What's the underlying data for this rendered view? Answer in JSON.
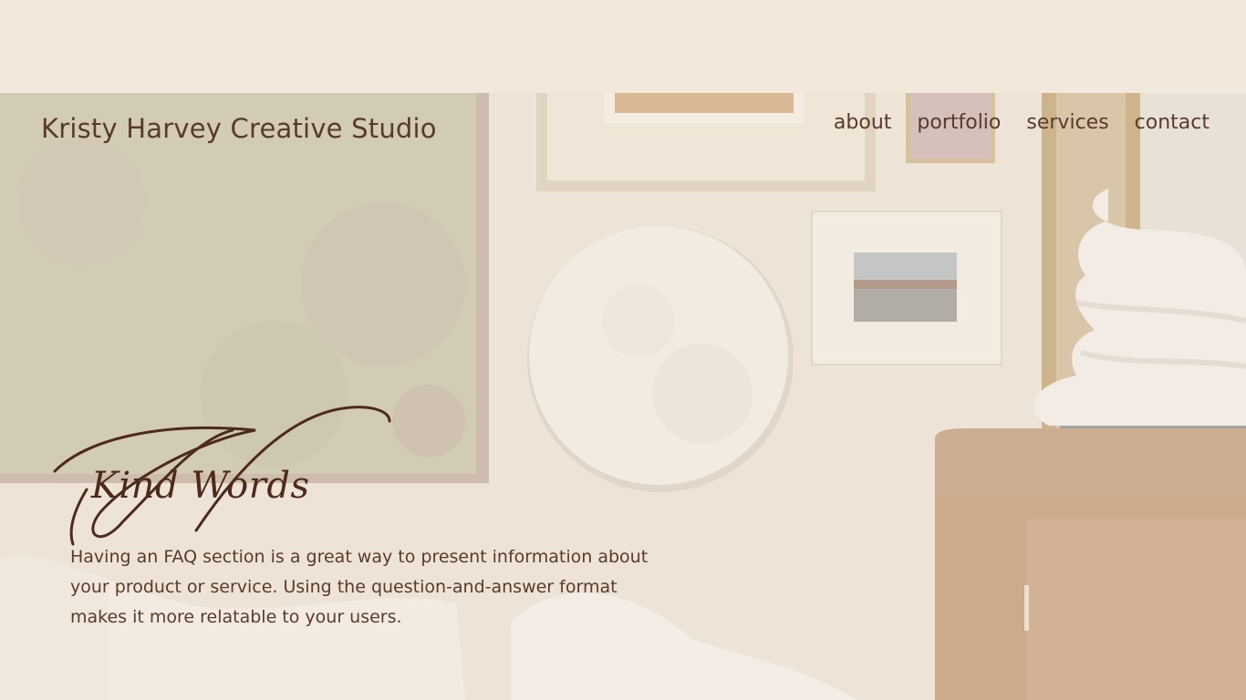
{
  "site": {
    "brand": "Kristy Harvey Creative Studio"
  },
  "nav": {
    "items": [
      {
        "label": "about"
      },
      {
        "label": "portfolio"
      },
      {
        "label": "services"
      },
      {
        "label": "contact"
      }
    ]
  },
  "section": {
    "heading": "Kind Words",
    "body": "Having an FAQ section is a great way to present information about your product or service. Using the question-and-answer format makes it more relatable to your users."
  },
  "colors": {
    "background": "#f3e8dc",
    "text": "#5a3a2b",
    "script": "#4d2a1c"
  }
}
